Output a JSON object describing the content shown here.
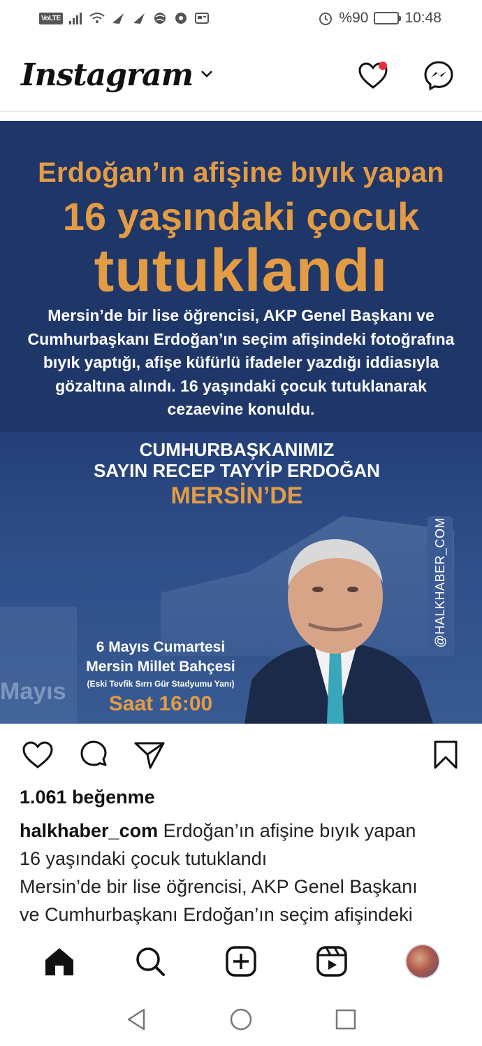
{
  "status_bar": {
    "volte": "VoLTE",
    "battery_text": "%90",
    "battery_level": 0.9,
    "time": "10:48",
    "icons": [
      "signal-icon",
      "wifi-icon",
      "notification-icons",
      "alarm-icon",
      "battery-icon"
    ]
  },
  "header": {
    "logo": "Instagram",
    "icons": [
      "chevron-down-icon",
      "heart-icon",
      "messenger-icon"
    ],
    "notification_color": "#ed2d3b"
  },
  "post": {
    "headline_1": "Erdoğan’ın afişine bıyık yapan",
    "headline_2": "16 yaşındaki çocuk",
    "headline_3": "tutuklandı",
    "body": "Mersin’de bir lise öğrencisi, AKP Genel Başkanı ve Cumhurbaşkanı Erdoğan’ın seçim afişindeki fotoğrafına bıyık yaptığı, afişe küfürlü ifadeler yazdığı iddiasıyla gözaltına alındı. 16 yaşındaki çocuk tutuklanarak cezaevine konuldu.",
    "poster": {
      "line_1": "CUMHURBAŞKANIMIZ",
      "line_2": "SAYIN RECEP TAYYİP ERDOĞAN",
      "line_3": "MERSİN’DE",
      "event_date": "6 Mayıs Cumartesi",
      "event_place": "Mersin Millet Bahçesi",
      "event_note": "(Eski Tevfik Sırrı Gür Stadyumu Yanı)",
      "event_time": "Saat 16:00",
      "faded_text": "Mayıs",
      "watermark": "@HALKHABER_COM"
    },
    "colors": {
      "accent": "#e39c44",
      "navy": "#1f3668"
    }
  },
  "actions": {
    "icons": [
      "like-heart-icon",
      "comment-icon",
      "share-icon",
      "bookmark-icon"
    ]
  },
  "likes": "1.061 beğenme",
  "caption": {
    "username": "halkhaber_com",
    "text_line_1": "Erdoğan’ın afişine bıyık yapan",
    "text_line_2": "16 yaşındaki çocuk tutuklandı",
    "text_line_3": "Mersin’de bir lise öğrencisi, AKP Genel Başkanı",
    "text_line_4": "ve Cumhurbaşkanı Erdoğan’ın seçim afişindeki"
  },
  "bottom_nav": {
    "icons": [
      "home-icon",
      "search-icon",
      "create-icon",
      "reels-icon",
      "profile-avatar"
    ]
  },
  "system_nav": {
    "icons": [
      "back-icon",
      "home-circle-icon",
      "recents-icon"
    ]
  }
}
